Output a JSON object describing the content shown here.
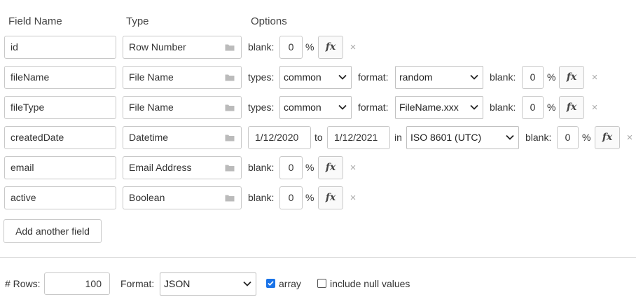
{
  "headers": {
    "field_name": "Field Name",
    "type": "Type",
    "options": "Options"
  },
  "fields": [
    {
      "name": "id",
      "type": "Row Number",
      "blank_label": "blank:",
      "blank": "0",
      "pct": "%",
      "fx": "fx",
      "remove": "×"
    },
    {
      "name": "fileName",
      "type": "File Name",
      "types_label": "types:",
      "types_value": "common",
      "format_label": "format:",
      "format_value": "random",
      "blank_label": "blank:",
      "blank": "0",
      "pct": "%",
      "fx": "fx",
      "remove": "×"
    },
    {
      "name": "fileType",
      "type": "File Name",
      "types_label": "types:",
      "types_value": "common",
      "format_label": "format:",
      "format_value": "FileName.xxx",
      "blank_label": "blank:",
      "blank": "0",
      "pct": "%",
      "fx": "fx",
      "remove": "×"
    },
    {
      "name": "createdDate",
      "type": "Datetime",
      "from": "1/12/2020",
      "to_label": "to",
      "to": "1/12/2021",
      "in_label": "in",
      "format_value": "ISO 8601 (UTC)",
      "blank_label": "blank:",
      "blank": "0",
      "pct": "%",
      "fx": "fx",
      "remove": "×"
    },
    {
      "name": "email",
      "type": "Email Address",
      "blank_label": "blank:",
      "blank": "0",
      "pct": "%",
      "fx": "fx",
      "remove": "×"
    },
    {
      "name": "active",
      "type": "Boolean",
      "blank_label": "blank:",
      "blank": "0",
      "pct": "%",
      "fx": "fx",
      "remove": "×"
    }
  ],
  "add_field_label": "Add another field",
  "footer": {
    "rows_label": "# Rows:",
    "rows_value": "100",
    "format_label": "Format:",
    "format_value": "JSON",
    "array_label": "array",
    "array_checked": true,
    "null_label": "include null values",
    "null_checked": false
  },
  "colors": {
    "accent": "#1a73e8",
    "border": "#c8c8c8",
    "text": "#333333",
    "muted": "#aaaaaa"
  }
}
